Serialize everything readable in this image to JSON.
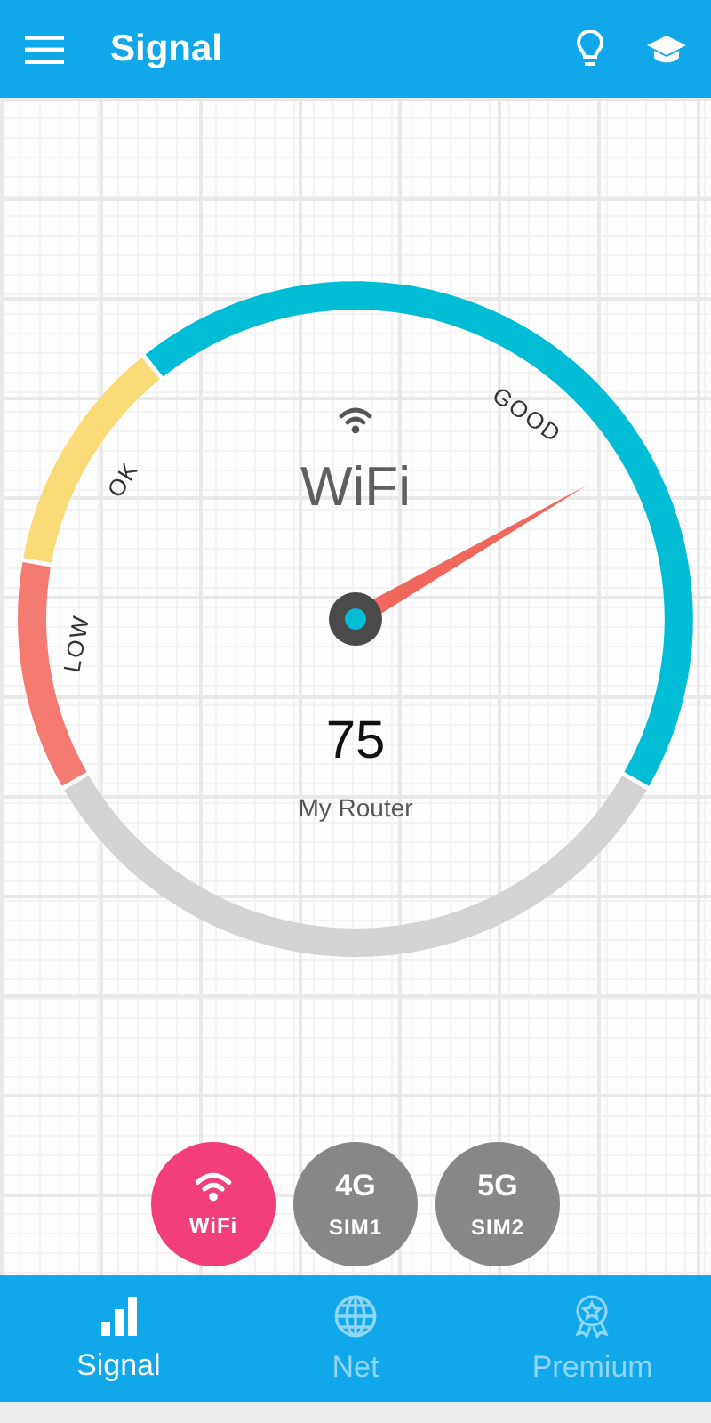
{
  "app_bar": {
    "title": "Signal"
  },
  "gauge": {
    "title": "WiFi",
    "value": "75",
    "network": "My Router",
    "zones": [
      {
        "label": "LOW",
        "color": "#f47a72"
      },
      {
        "label": "OK",
        "color": "#f9dc78"
      },
      {
        "label": "GOOD",
        "color": "#00bcd4"
      }
    ]
  },
  "modes": [
    {
      "kind": "wifi",
      "label": "WiFi",
      "selected": true
    },
    {
      "kind": "cell",
      "network": "4G",
      "label": "SIM1",
      "selected": false
    },
    {
      "kind": "cell",
      "network": "5G",
      "label": "SIM2",
      "selected": false
    }
  ],
  "nav": [
    {
      "kind": "bars",
      "label": "Signal",
      "selected": true
    },
    {
      "kind": "globe",
      "label": "Net",
      "selected": false
    },
    {
      "kind": "award",
      "label": "Premium",
      "selected": false
    }
  ]
}
